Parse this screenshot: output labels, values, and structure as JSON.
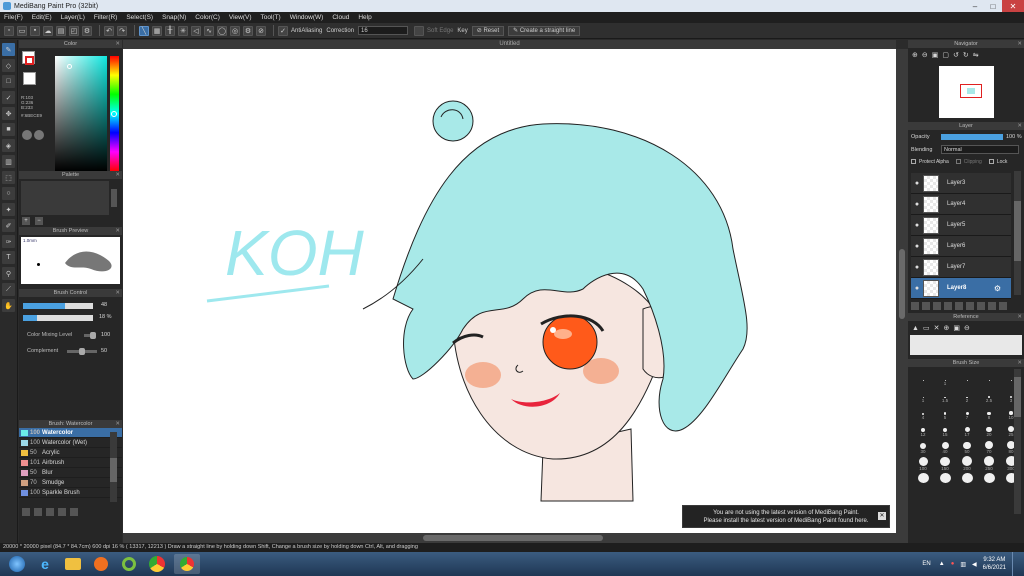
{
  "window": {
    "title": "MediBang Paint Pro (32bit)",
    "controls": [
      "–",
      "□",
      "✕"
    ]
  },
  "menu": [
    "File(F)",
    "Edit(E)",
    "Layer(L)",
    "Filter(R)",
    "Select(S)",
    "Snap(N)",
    "Color(C)",
    "View(V)",
    "Tool(T)",
    "Window(W)",
    "Cloud",
    "Help"
  ],
  "toolbar": {
    "antialiasing_label": "AntiAliasing",
    "correction_label": "Correction",
    "correction_value": "16",
    "soft_edge_label": "Soft Edge",
    "key_label": "Key",
    "reset_label": "Reset",
    "straight_line_label": "Create a straight line"
  },
  "document": {
    "tab_title": "Untitled"
  },
  "color_panel": {
    "title": "Color",
    "r": "R:103",
    "g": "G:236",
    "b": "B:233",
    "hex": "#:6BECE9",
    "accent": "#6BECE9"
  },
  "palette_panel": {
    "title": "Palette"
  },
  "brush_preview_panel": {
    "title": "Brush Preview",
    "size": "1.0mm"
  },
  "brush_control_panel": {
    "title": "Brush Control",
    "size_value": "48",
    "opacity_value": "18 %",
    "color_mixing_label": "Color Mixing Level",
    "color_mixing_value": "100",
    "complement_label": "Complement",
    "complement_value": "50"
  },
  "brush_list_panel": {
    "title": "Brush: Watercolor",
    "items": [
      {
        "num": "100",
        "name": "Watercolor",
        "color": "#6BECE9",
        "selected": true
      },
      {
        "num": "100",
        "name": "Watercolor (Wet)",
        "color": "#9ad8e8",
        "selected": false
      },
      {
        "num": "50",
        "name": "Acrylic",
        "color": "#f0c040",
        "selected": false
      },
      {
        "num": "101",
        "name": "Airbrush",
        "color": "#f09090",
        "selected": false
      },
      {
        "num": "50",
        "name": "Blur",
        "color": "#e0a0c0",
        "selected": false
      },
      {
        "num": "70",
        "name": "Smudge",
        "color": "#d0a080",
        "selected": false
      },
      {
        "num": "100",
        "name": "Sparkle Brush",
        "color": "#7090e0",
        "selected": false
      }
    ]
  },
  "navigator_panel": {
    "title": "Navigator"
  },
  "layer_panel": {
    "title": "Layer",
    "opacity_label": "Opacity",
    "opacity_value": "100 %",
    "blending_label": "Blending",
    "blending_value": "Normal",
    "protect_alpha_label": "Protect Alpha",
    "clipping_label": "Clipping",
    "lock_label": "Lock",
    "layers": [
      {
        "name": "Layer3",
        "selected": false
      },
      {
        "name": "Layer4",
        "selected": false
      },
      {
        "name": "Layer5",
        "selected": false
      },
      {
        "name": "Layer6",
        "selected": false
      },
      {
        "name": "Layer7",
        "selected": false
      },
      {
        "name": "Layer8",
        "selected": true
      }
    ]
  },
  "reference_panel": {
    "title": "Reference"
  },
  "brush_size_panel": {
    "title": "Brush Size",
    "sizes": [
      {
        "label": "",
        "v": 1
      },
      {
        "label": "1",
        "v": 1
      },
      {
        "label": "",
        "v": 1
      },
      {
        "label": "",
        "v": 1
      },
      {
        "label": "",
        "v": 1
      },
      {
        "label": "1",
        "v": 1
      },
      {
        "label": "1.5",
        "v": 1.2
      },
      {
        "label": "2",
        "v": 1.5
      },
      {
        "label": "2.5",
        "v": 1.7
      },
      {
        "label": "3",
        "v": 2
      },
      {
        "label": "4",
        "v": 2.3
      },
      {
        "label": "5",
        "v": 2.6
      },
      {
        "label": "7",
        "v": 3
      },
      {
        "label": "8",
        "v": 3.3
      },
      {
        "label": "10",
        "v": 3.6
      },
      {
        "label": "12",
        "v": 4
      },
      {
        "label": "15",
        "v": 4.5
      },
      {
        "label": "17",
        "v": 5
      },
      {
        "label": "20",
        "v": 5.5
      },
      {
        "label": "25",
        "v": 6
      },
      {
        "label": "30",
        "v": 6.5
      },
      {
        "label": "40",
        "v": 7
      },
      {
        "label": "50",
        "v": 7.5
      },
      {
        "label": "70",
        "v": 8
      },
      {
        "label": "80",
        "v": 8.5
      },
      {
        "label": "100",
        "v": 9
      },
      {
        "label": "150",
        "v": 9.5
      },
      {
        "label": "200",
        "v": 10
      },
      {
        "label": "250",
        "v": 10.5
      },
      {
        "label": "300",
        "v": 11
      },
      {
        "label": "",
        "v": 11
      },
      {
        "label": "",
        "v": 11
      },
      {
        "label": "",
        "v": 11
      },
      {
        "label": "",
        "v": 11
      },
      {
        "label": "",
        "v": 11
      }
    ]
  },
  "notice": {
    "line1": "You are not using the latest version of MediBang Paint.",
    "line2": "Please install the latest version of MediBang Paint found here."
  },
  "status": "20000 * 20000 pixel   (84.7 * 84.7cm)   600 dpi   16 %   ( 13317, 12213 )   Draw a straight line by holding down Shift, Change a brush size by holding down Ctrl, Alt, and dragging",
  "canvas_art": {
    "signature_text": "KOH",
    "hair_color": "#a8e9e8",
    "eye_color": "#ff5a1a",
    "blush_color": "#f4a27f",
    "mouth_color": "#e8243c",
    "skin_color": "#f6e6e0"
  },
  "taskbar": {
    "lang": "EN",
    "time": "9:32 AM",
    "date": "6/6/2021"
  }
}
